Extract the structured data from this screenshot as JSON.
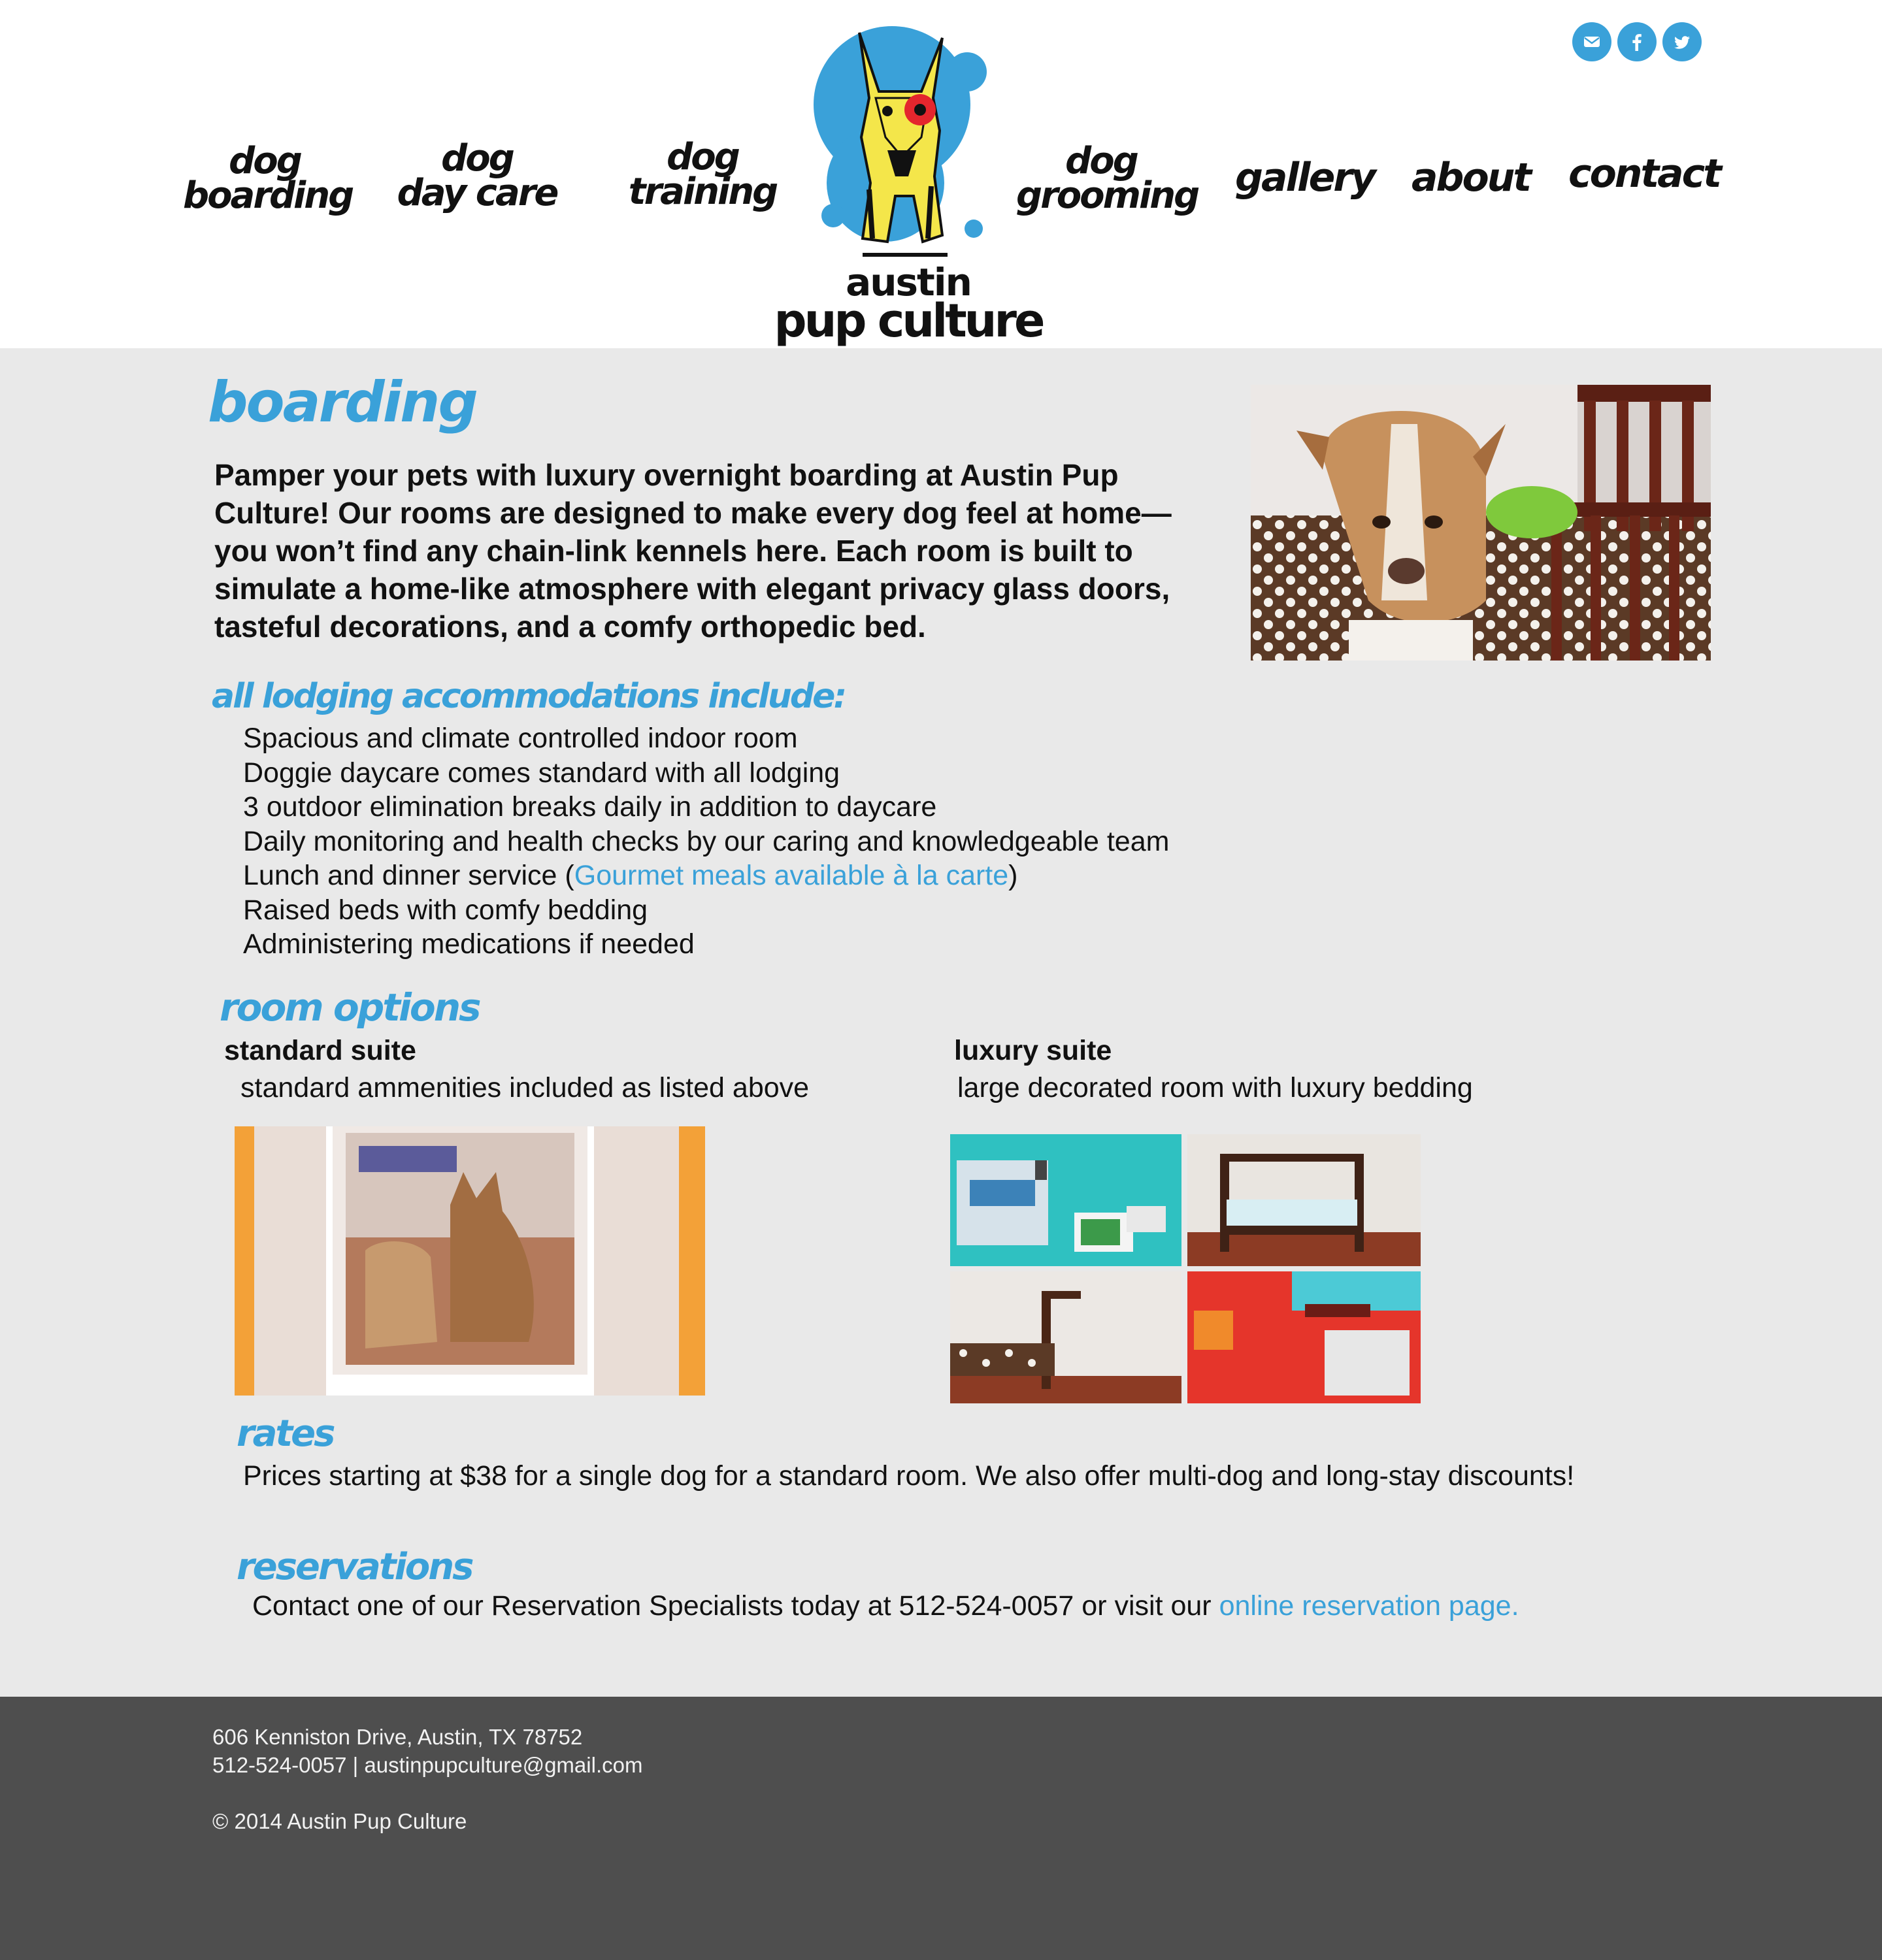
{
  "brand": {
    "logo_line1": "austin",
    "logo_line2": "pup culture"
  },
  "social": [
    {
      "name": "email",
      "icon": "email-icon"
    },
    {
      "name": "facebook",
      "icon": "facebook-icon"
    },
    {
      "name": "twitter",
      "icon": "twitter-icon"
    }
  ],
  "nav": {
    "boarding": [
      "dog",
      "boarding"
    ],
    "daycare": [
      "dog",
      "day care"
    ],
    "training": [
      "dog",
      "training"
    ],
    "grooming": [
      "dog",
      "grooming"
    ],
    "gallery": "gallery",
    "about": "about",
    "contact": "contact"
  },
  "page": {
    "title": "boarding",
    "intro": "Pamper your pets with luxury overnight boarding at Austin Pup Culture! Our rooms are designed to make every dog feel at home—you won’t find any chain-link kennels here. Each room is built to simulate a home-like atmosphere with elegant privacy glass doors, tasteful decorations, and a comfy orthopedic bed."
  },
  "amenities": {
    "heading": "all lodging accommodations include:",
    "items": [
      "Spacious and climate controlled indoor room",
      "Doggie daycare comes standard with all lodging",
      "3 outdoor elimination breaks daily in addition to daycare",
      "Daily monitoring and health checks by our caring and knowledgeable team"
    ],
    "meals_prefix": "Lunch and dinner service (",
    "meals_link": "Gourmet meals available à la carte",
    "meals_suffix": ")",
    "items_after": [
      "Raised beds with comfy bedding",
      "Administering medications if needed"
    ]
  },
  "room_options": {
    "heading": "room options",
    "standard": {
      "title": "standard suite",
      "desc": "standard ammenities included as listed above"
    },
    "luxury": {
      "title": "luxury suite",
      "desc": "large decorated room with luxury bedding"
    }
  },
  "rates": {
    "heading": "rates",
    "text": "Prices starting at $38 for a single dog for a standard room. We also offer multi-dog and long-stay discounts!"
  },
  "reservations": {
    "heading": "reservations",
    "text_prefix": "Contact one of our Reservation Specialists today at 512-524-0057 or visit our ",
    "link": "online reservation page."
  },
  "footer": {
    "address": "606 Kenniston Drive, Austin, TX 78752",
    "contact": "512-524-0057 | austinpupculture@gmail.com",
    "copyright": "© 2014 Austin Pup Culture"
  },
  "colors": {
    "accent": "#3aa1d9",
    "logo_yellow": "#f4e64a",
    "logo_red": "#e4262d",
    "background": "#e9e9e9",
    "footer": "#4e4e4e"
  }
}
